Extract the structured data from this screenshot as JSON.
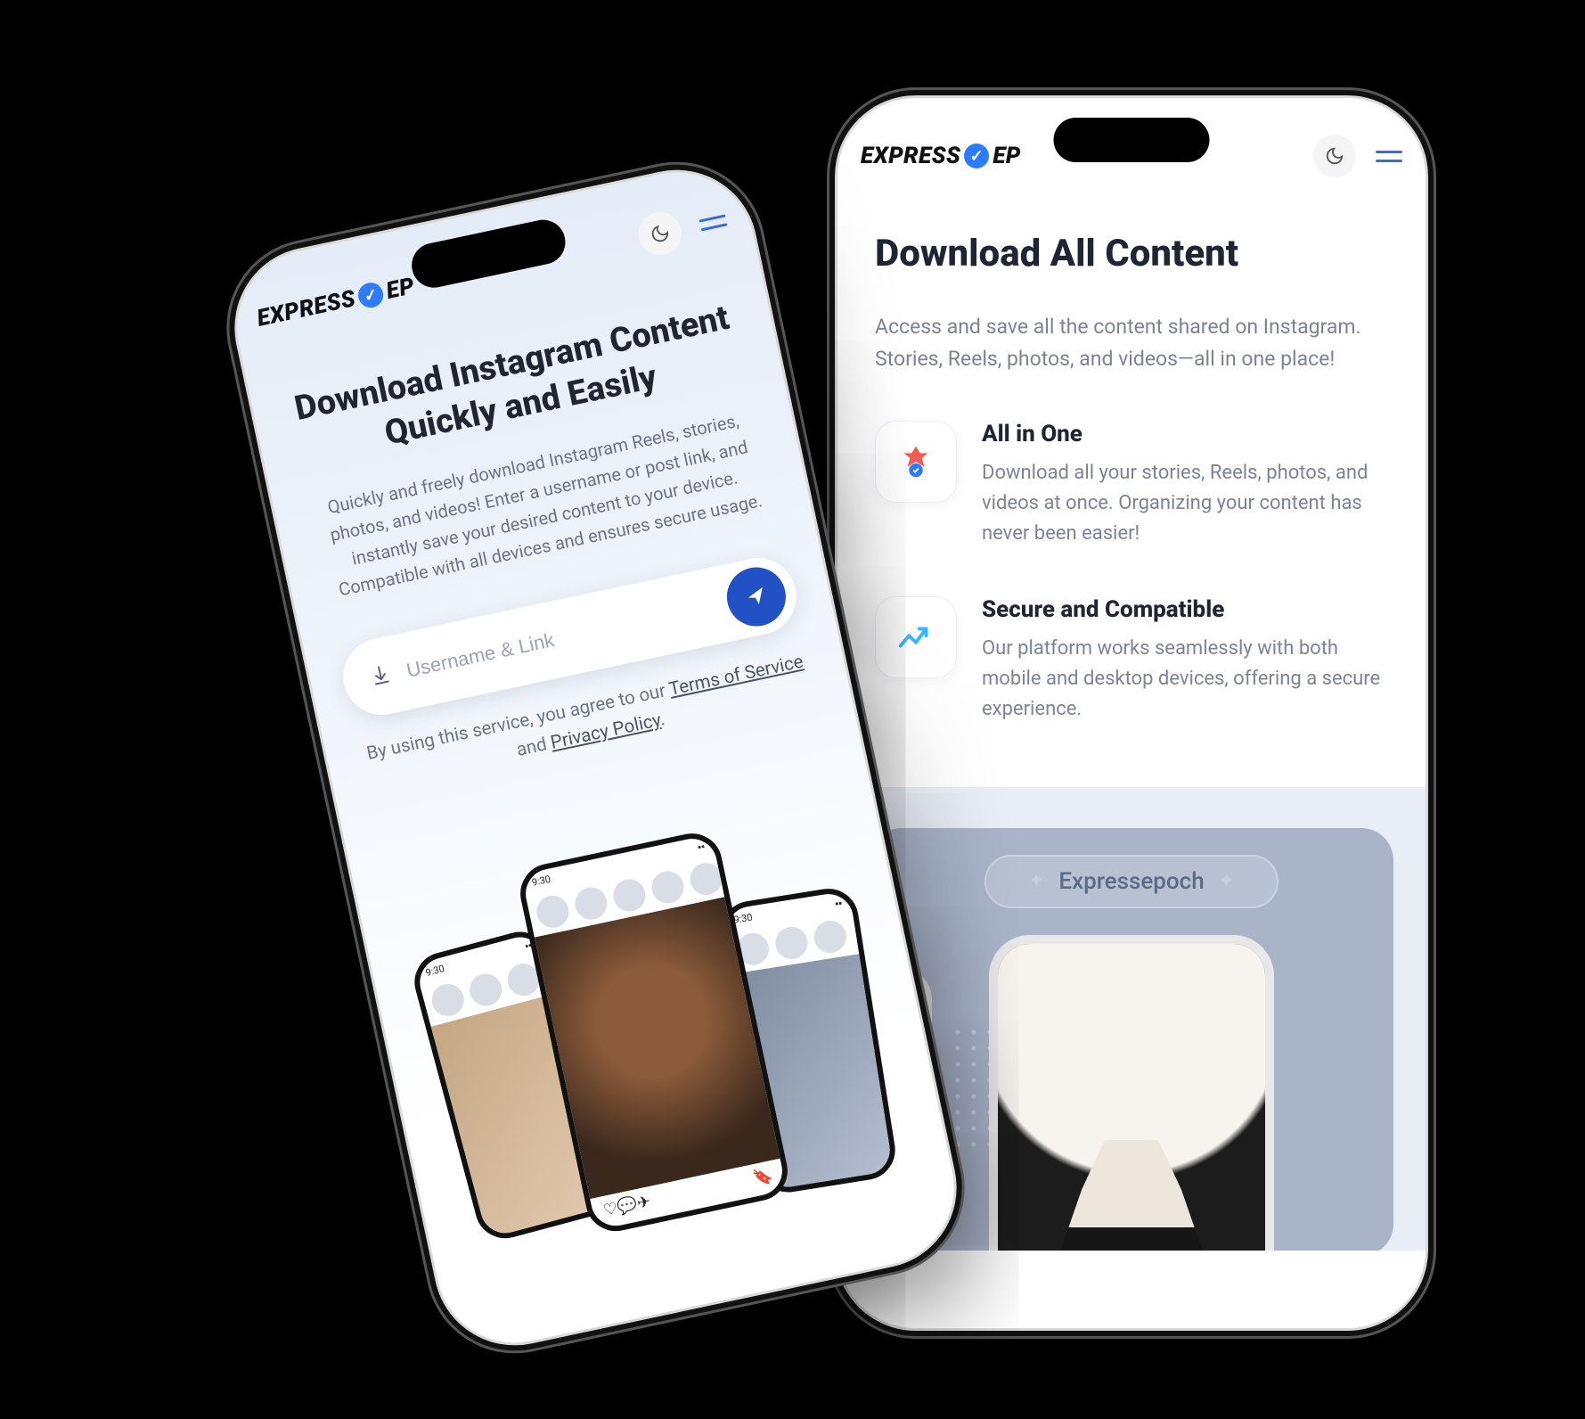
{
  "brand": {
    "part1": "EXPRESS",
    "part2": "EP"
  },
  "left": {
    "title": "Download Instagram Content Quickly and Easily",
    "subtitle": "Quickly and freely download Instagram Reels, stories, photos, and videos! Enter a username or post link, and instantly save your desired content to your device. Compatible with all devices and ensures secure usage.",
    "search_placeholder": "Username & Link",
    "consent_prefix": "By using this service, you agree to our ",
    "tos": "Terms of Service",
    "and": " and ",
    "privacy": "Privacy Policy",
    "mini_time": "9:30"
  },
  "right": {
    "heading": "Download All Content",
    "intro": "Access and save all the content shared on Instagram. Stories, Reels, photos, and videos—all in one place!",
    "features": [
      {
        "title": "All in One",
        "desc": "Download all your stories, Reels, photos, and videos at once. Organizing your content has never been easier!"
      },
      {
        "title": "Secure and Compatible",
        "desc": "Our platform works seamlessly with both mobile and desktop devices, offering a secure experience."
      }
    ],
    "showcase_label": "Expressepoch"
  }
}
